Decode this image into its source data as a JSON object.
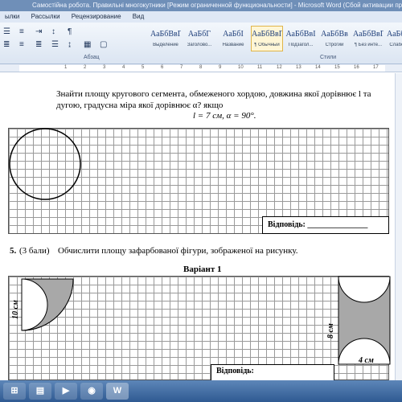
{
  "window": {
    "title": "Самостійна робота. Правильні многокутники [Режим ограниченной функциональности]  -  Microsoft Word (Сбой активации продукта)"
  },
  "menu": [
    "ылки",
    "Рассылки",
    "Рецензирование",
    "Вид"
  ],
  "ribbon": {
    "paragraph_label": "Абзац",
    "styles_label": "Стили",
    "styles": [
      {
        "sample": "АаБбВвГ",
        "name": "Выделение"
      },
      {
        "sample": "АаБбГ",
        "name": "Заголово..."
      },
      {
        "sample": "АаБбI",
        "name": "Название"
      },
      {
        "sample": "АаБбВвГ",
        "name": "¶ Обычный",
        "selected": true
      },
      {
        "sample": "АаБбВвI",
        "name": "Подзагол..."
      },
      {
        "sample": "АаБбВв",
        "name": "Строгий"
      },
      {
        "sample": "АаБбВвГ",
        "name": "¶ Без инте..."
      },
      {
        "sample": "АаБбВвГ",
        "name": "Слабое в..."
      }
    ],
    "ruler_numbers": [
      "1",
      "2",
      "3",
      "4",
      "5",
      "6",
      "7",
      "8",
      "9",
      "10",
      "11",
      "12",
      "13",
      "14",
      "15",
      "16",
      "17"
    ]
  },
  "doc": {
    "task4_line1": "Знайти  площу  кругового  сегмента,  обмеженого  хордою,  довжина  якої  дорівнює  l та",
    "task4_line2": "дугою,  градусна  міра  якої  дорівнює  α?  якщо",
    "task4_given": "l = 7 см,  α = 90°.",
    "answer_label": "Відповідь: _______________",
    "task5_num": "5.",
    "task5_points": "(3 бали)",
    "task5_text": "Обчислити  площу  зафарбованої фігури,  зображеної на  рисунку.",
    "variant": "Варіант 1",
    "label_10": "10 см",
    "label_8": "8 см",
    "label_4": "4 см",
    "answer2_label": "Відповідь:"
  },
  "taskbar": {
    "app_w": "W"
  },
  "colors": {
    "title_bg": "#6f8fb8",
    "shade": "#a8a8a8"
  }
}
